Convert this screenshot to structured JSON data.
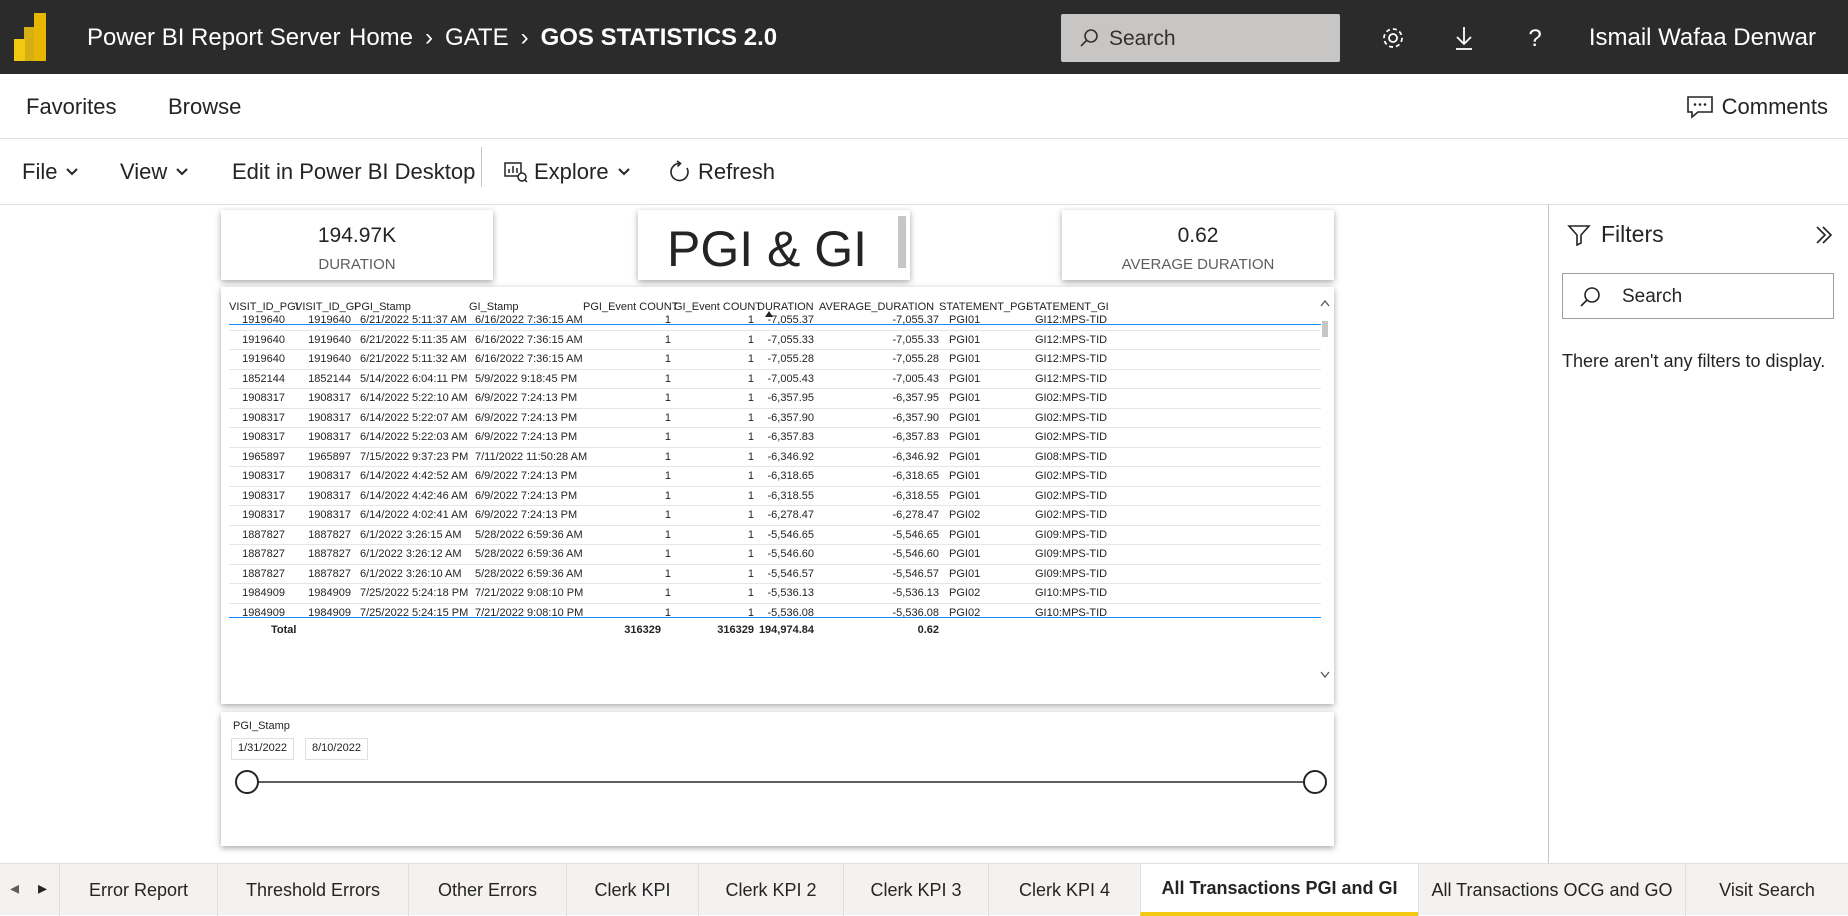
{
  "header": {
    "app_title": "Power BI Report Server",
    "breadcrumbs": [
      "Home",
      "GATE",
      "GOS STATISTICS 2.0"
    ],
    "search_placeholder": "Search",
    "user_name": "Ismail Wafaa Denwar"
  },
  "nav": {
    "favorites": "Favorites",
    "browse": "Browse",
    "comments": "Comments"
  },
  "toolbar": {
    "file": "File",
    "view": "View",
    "edit": "Edit in Power BI Desktop",
    "explore": "Explore",
    "refresh": "Refresh"
  },
  "cards": {
    "duration_value": "194.97K",
    "duration_label": "DURATION",
    "title": "PGI & GI",
    "avg_value": "0.62",
    "avg_label": "AVERAGE DURATION"
  },
  "table": {
    "columns": [
      "VISIT_ID_PGI",
      "VISIT_ID_GI",
      "PGI_Stamp",
      "GI_Stamp",
      "PGI_Event COUNT",
      "GI_Event COUNT",
      "DURATION",
      "AVERAGE_DURATION",
      "STATEMENT_PGI",
      "STATEMENT_GI"
    ],
    "rows": [
      [
        "1919640",
        "1919640",
        "6/21/2022 5:11:37 AM",
        "6/16/2022 7:36:15 AM",
        "1",
        "1",
        "-7,055.37",
        "-7,055.37",
        "PGI01",
        "GI12:MPS-TID"
      ],
      [
        "1919640",
        "1919640",
        "6/21/2022 5:11:35 AM",
        "6/16/2022 7:36:15 AM",
        "1",
        "1",
        "-7,055.33",
        "-7,055.33",
        "PGI01",
        "GI12:MPS-TID"
      ],
      [
        "1919640",
        "1919640",
        "6/21/2022 5:11:32 AM",
        "6/16/2022 7:36:15 AM",
        "1",
        "1",
        "-7,055.28",
        "-7,055.28",
        "PGI01",
        "GI12:MPS-TID"
      ],
      [
        "1852144",
        "1852144",
        "5/14/2022 6:04:11 PM",
        "5/9/2022 9:18:45 PM",
        "1",
        "1",
        "-7,005.43",
        "-7,005.43",
        "PGI01",
        "GI12:MPS-TID"
      ],
      [
        "1908317",
        "1908317",
        "6/14/2022 5:22:10 AM",
        "6/9/2022 7:24:13 PM",
        "1",
        "1",
        "-6,357.95",
        "-6,357.95",
        "PGI01",
        "GI02:MPS-TID"
      ],
      [
        "1908317",
        "1908317",
        "6/14/2022 5:22:07 AM",
        "6/9/2022 7:24:13 PM",
        "1",
        "1",
        "-6,357.90",
        "-6,357.90",
        "PGI01",
        "GI02:MPS-TID"
      ],
      [
        "1908317",
        "1908317",
        "6/14/2022 5:22:03 AM",
        "6/9/2022 7:24:13 PM",
        "1",
        "1",
        "-6,357.83",
        "-6,357.83",
        "PGI01",
        "GI02:MPS-TID"
      ],
      [
        "1965897",
        "1965897",
        "7/15/2022 9:37:23 PM",
        "7/11/2022 11:50:28 AM",
        "1",
        "1",
        "-6,346.92",
        "-6,346.92",
        "PGI01",
        "GI08:MPS-TID"
      ],
      [
        "1908317",
        "1908317",
        "6/14/2022 4:42:52 AM",
        "6/9/2022 7:24:13 PM",
        "1",
        "1",
        "-6,318.65",
        "-6,318.65",
        "PGI01",
        "GI02:MPS-TID"
      ],
      [
        "1908317",
        "1908317",
        "6/14/2022 4:42:46 AM",
        "6/9/2022 7:24:13 PM",
        "1",
        "1",
        "-6,318.55",
        "-6,318.55",
        "PGI01",
        "GI02:MPS-TID"
      ],
      [
        "1908317",
        "1908317",
        "6/14/2022 4:02:41 AM",
        "6/9/2022 7:24:13 PM",
        "1",
        "1",
        "-6,278.47",
        "-6,278.47",
        "PGI02",
        "GI02:MPS-TID"
      ],
      [
        "1887827",
        "1887827",
        "6/1/2022 3:26:15 AM",
        "5/28/2022 6:59:36 AM",
        "1",
        "1",
        "-5,546.65",
        "-5,546.65",
        "PGI01",
        "GI09:MPS-TID"
      ],
      [
        "1887827",
        "1887827",
        "6/1/2022 3:26:12 AM",
        "5/28/2022 6:59:36 AM",
        "1",
        "1",
        "-5,546.60",
        "-5,546.60",
        "PGI01",
        "GI09:MPS-TID"
      ],
      [
        "1887827",
        "1887827",
        "6/1/2022 3:26:10 AM",
        "5/28/2022 6:59:36 AM",
        "1",
        "1",
        "-5,546.57",
        "-5,546.57",
        "PGI01",
        "GI09:MPS-TID"
      ],
      [
        "1984909",
        "1984909",
        "7/25/2022 5:24:18 PM",
        "7/21/2022 9:08:10 PM",
        "1",
        "1",
        "-5,536.13",
        "-5,536.13",
        "PGI02",
        "GI10:MPS-TID"
      ],
      [
        "1984909",
        "1984909",
        "7/25/2022 5:24:15 PM",
        "7/21/2022 9:08:10 PM",
        "1",
        "1",
        "-5,536.08",
        "-5,536.08",
        "PGI02",
        "GI10:MPS-TID"
      ]
    ],
    "total": {
      "label": "Total",
      "pgi_count": "316329",
      "gi_count": "316329",
      "duration": "194,974.84",
      "avg": "0.62"
    }
  },
  "slicer": {
    "title": "PGI_Stamp",
    "start": "1/31/2022",
    "end": "8/10/2022"
  },
  "filters": {
    "title": "Filters",
    "search_placeholder": "Search",
    "empty": "There aren't any filters to display."
  },
  "tabs": [
    {
      "label": "Error Report",
      "active": false
    },
    {
      "label": "Threshold Errors",
      "active": false
    },
    {
      "label": "Other Errors",
      "active": false
    },
    {
      "label": "Clerk KPI",
      "active": false
    },
    {
      "label": "Clerk KPI 2",
      "active": false
    },
    {
      "label": "Clerk KPI 3",
      "active": false
    },
    {
      "label": "Clerk KPI 4",
      "active": false
    },
    {
      "label": "All Transactions PGI and GI",
      "active": true
    },
    {
      "label": "All Transactions OCG and GO",
      "active": false
    },
    {
      "label": "Visit Search",
      "active": false
    }
  ],
  "colors": {
    "topbar": "#2b2b2b",
    "accent": "#f2c811",
    "table_line": "#118dff"
  }
}
